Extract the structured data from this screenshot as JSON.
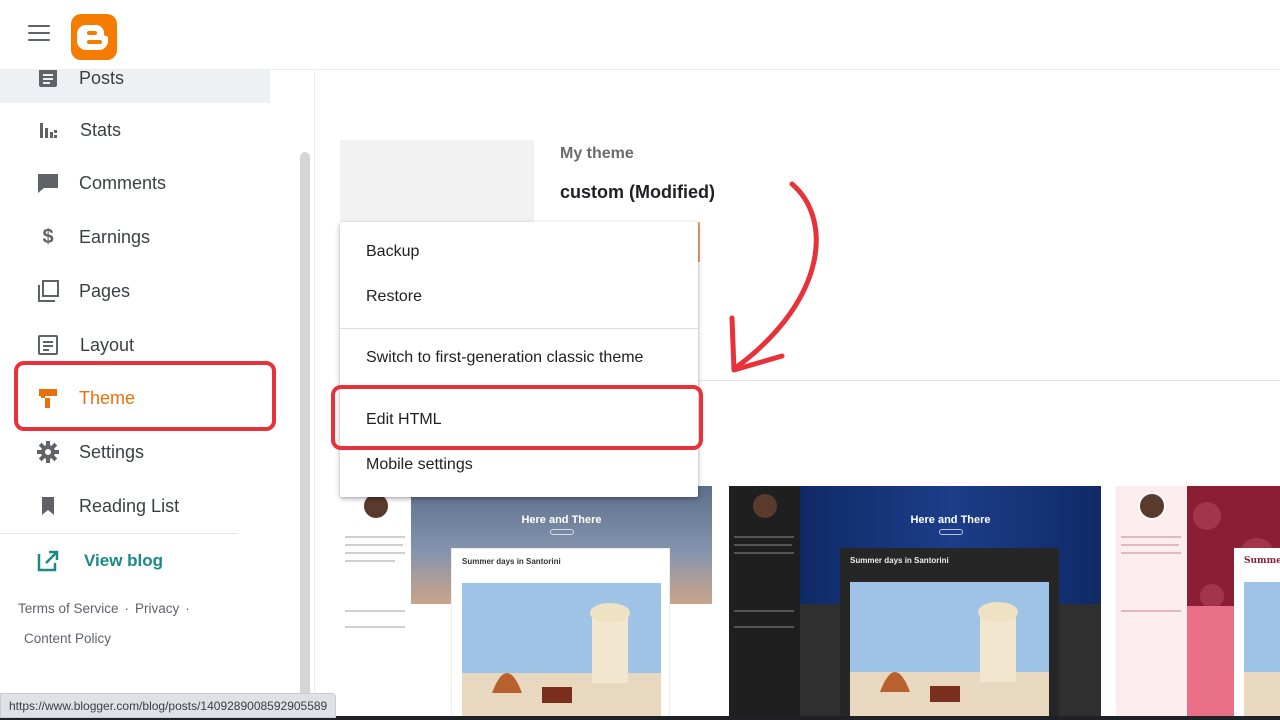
{
  "header": {
    "menu_icon": "hamburger-menu-icon",
    "logo_icon": "blogger-logo"
  },
  "sidebar": {
    "items": [
      {
        "label": "Posts",
        "icon": "posts-icon"
      },
      {
        "label": "Stats",
        "icon": "stats-icon"
      },
      {
        "label": "Comments",
        "icon": "comments-icon"
      },
      {
        "label": "Earnings",
        "icon": "dollar-icon"
      },
      {
        "label": "Pages",
        "icon": "pages-icon"
      },
      {
        "label": "Layout",
        "icon": "layout-icon"
      },
      {
        "label": "Theme",
        "icon": "theme-roller-icon",
        "active": true
      },
      {
        "label": "Settings",
        "icon": "gear-icon"
      },
      {
        "label": "Reading List",
        "icon": "bookmark-icon"
      }
    ],
    "view_blog": {
      "label": "View blog",
      "icon": "external-link-icon"
    },
    "footer": {
      "terms": "Terms of Service",
      "privacy": "Privacy",
      "content_policy": "Content Policy",
      "separator": "·"
    }
  },
  "main": {
    "my_theme_label": "My theme",
    "theme_name": "custom (Modified)"
  },
  "dropdown": {
    "items": [
      "Backup",
      "Restore",
      "Switch to first-generation classic theme",
      "Edit HTML",
      "Mobile settings"
    ]
  },
  "theme_previews": [
    {
      "hero_title": "Here and There",
      "post_title": "Summer days in Santorini",
      "style": "light"
    },
    {
      "hero_title": "Here and There",
      "post_title": "Summer days in Santorini",
      "style": "dark"
    },
    {
      "post_title": "Summer d",
      "style": "pink"
    }
  ],
  "status_url": "https://www.blogger.com/blog/posts/1409289008592905589",
  "colors": {
    "accent": "#e8710a",
    "annotation": "#e8323a",
    "link": "#1a8a84"
  }
}
